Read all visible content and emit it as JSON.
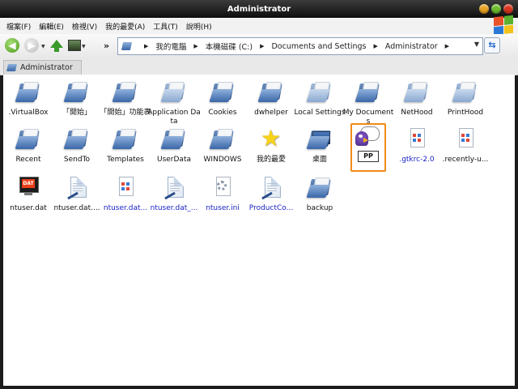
{
  "window": {
    "title": "Administrator"
  },
  "menu": {
    "items": [
      "檔案(F)",
      "編輯(E)",
      "檢視(V)",
      "我的最愛(A)",
      "工具(T)",
      "說明(H)"
    ]
  },
  "toolbar": {
    "chevron": "»",
    "address_segments": [
      "我的電腦",
      "本機磁碟 (C:)",
      "Documents and Settings",
      "Administrator"
    ]
  },
  "tab": {
    "label": "Administrator"
  },
  "items": [
    {
      "label": ".VirtualBox",
      "icon": "folder-icon",
      "blue": false
    },
    {
      "label": "「開始」",
      "icon": "folder-icon",
      "blue": false
    },
    {
      "label": "「開始」功能表",
      "icon": "folder-icon",
      "blue": false
    },
    {
      "label": "Application Data",
      "icon": "folder-icon",
      "blue": false
    },
    {
      "label": "Cookies",
      "icon": "folder-icon",
      "blue": false
    },
    {
      "label": "dwhelper",
      "icon": "folder-icon",
      "blue": false
    },
    {
      "label": "Local Settings",
      "icon": "folder-icon",
      "blue": false
    },
    {
      "label": "My Documents",
      "icon": "folder-icon",
      "blue": false
    },
    {
      "label": "NetHood",
      "icon": "folder-icon",
      "blue": false
    },
    {
      "label": "PrintHood",
      "icon": "folder-icon",
      "blue": false
    },
    {
      "label": "Recent",
      "icon": "folder-icon",
      "blue": false
    },
    {
      "label": "SendTo",
      "icon": "folder-icon",
      "blue": false
    },
    {
      "label": "Templates",
      "icon": "folder-icon",
      "blue": false
    },
    {
      "label": "UserData",
      "icon": "folder-icon",
      "blue": false
    },
    {
      "label": "WINDOWS",
      "icon": "folder-icon",
      "blue": false
    },
    {
      "label": "我的最愛",
      "icon": "star-icon",
      "blue": false
    },
    {
      "label": "桌面",
      "icon": "desktop-folder-icon",
      "blue": false
    },
    {
      "label": "PP",
      "icon": "pp-app-icon",
      "blue": false,
      "selected": true
    },
    {
      "label": ".gtkrc-2.0",
      "icon": "config-file-icon",
      "blue": true
    },
    {
      "label": ".recently-u...",
      "icon": "config-file-icon",
      "blue": false
    },
    {
      "label": "ntuser.dat",
      "icon": "dat-file-icon",
      "blue": false
    },
    {
      "label": "ntuser.dat....",
      "icon": "document-icon",
      "blue": false
    },
    {
      "label": "ntuser.dat...",
      "icon": "config-file-icon",
      "blue": true
    },
    {
      "label": "ntuser.dat_...",
      "icon": "document-icon",
      "blue": true
    },
    {
      "label": "ntuser.ini",
      "icon": "settings-file-icon",
      "blue": true
    },
    {
      "label": "ProductCo...",
      "icon": "document-icon",
      "blue": true
    },
    {
      "label": "backup",
      "icon": "folder-icon",
      "blue": false
    }
  ]
}
